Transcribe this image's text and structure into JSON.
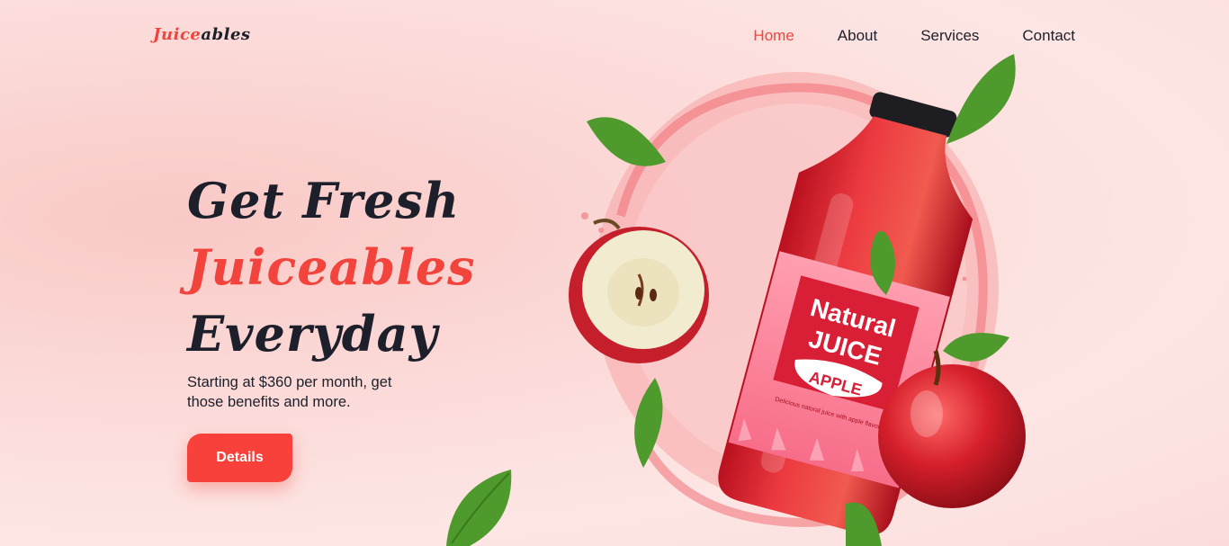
{
  "brand": {
    "logo_part1": "Juice",
    "logo_part2": "ables"
  },
  "nav": {
    "items": [
      {
        "label": "Home",
        "active": true
      },
      {
        "label": "About"
      },
      {
        "label": "Services"
      },
      {
        "label": "Contact"
      }
    ]
  },
  "hero": {
    "title_line1": "Get Fresh",
    "title_line2": "Juiceables",
    "title_line3": "Everyday",
    "subtitle": "Starting at $360 per month, get those benefits and more.",
    "cta_label": "Details"
  },
  "product": {
    "label_line1": "Natural",
    "label_line2": "JUICE",
    "flavor": "APPLE",
    "tagline": "Delicious natural juice with apple flavor"
  },
  "colors": {
    "accent": "#f2443c",
    "dark": "#1d1f2b",
    "leaf": "#4f9a2c",
    "background": "#fbdcda"
  }
}
